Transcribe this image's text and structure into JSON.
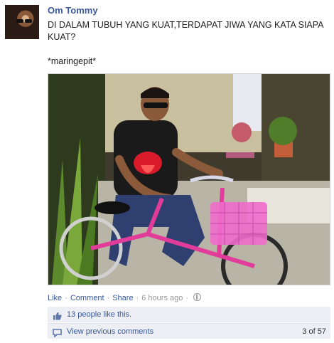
{
  "post": {
    "author": "Om Tommy",
    "message": "DI DALAM TUBUH YANG KUAT,TERDAPAT JIWA YANG KATA SIAPA KUAT?\n\n*maringepit*"
  },
  "actions": {
    "like": "Like",
    "comment": "Comment",
    "share": "Share",
    "timestamp": "6 hours ago",
    "separator": "·"
  },
  "likes": {
    "text": "13 people like this."
  },
  "comments": {
    "view_previous": "View previous comments",
    "count": "3 of 57"
  },
  "icons": {
    "like": "thumbs-up-icon",
    "comment": "comment-bubble-icon",
    "privacy": "globe-icon"
  },
  "colors": {
    "link": "#3b5998",
    "panel_bg": "#edeff4",
    "muted": "#999999"
  }
}
